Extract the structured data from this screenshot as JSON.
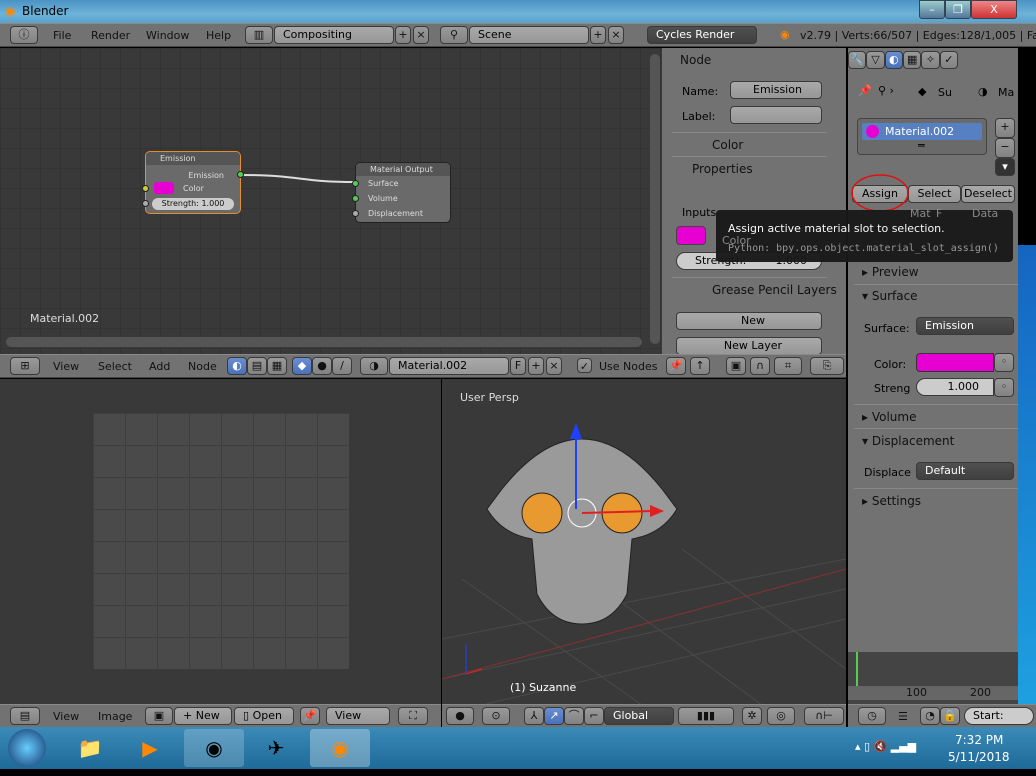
{
  "window": {
    "title": "Blender",
    "minimize": "–",
    "maximize": "❐",
    "close": "X"
  },
  "topbar": {
    "menus": [
      "File",
      "Render",
      "Window",
      "Help"
    ],
    "layout": "Compositing",
    "scene": "Scene",
    "engine": "Cycles Render",
    "stats": "v2.79 | Verts:66/507 | Edges:128/1,005 | Fa"
  },
  "node_editor": {
    "material_label": "Material.002",
    "emission_node": {
      "title": "Emission",
      "output": "Emission",
      "color_label": "Color",
      "strength": "Strength: 1.000"
    },
    "output_node": {
      "title": "Material Output",
      "inputs": [
        "Surface",
        "Volume",
        "Displacement"
      ]
    },
    "header": {
      "menus": [
        "View",
        "Select",
        "Add",
        "Node"
      ],
      "material": "Material.002",
      "fake_user": "F",
      "use_nodes": "Use Nodes",
      "use_nodes_checked": true
    }
  },
  "n_panel": {
    "node_title": "Node",
    "name_label": "Name:",
    "name_value": "Emission",
    "label_label": "Label:",
    "label_value": "",
    "color_title": "Color",
    "properties_title": "Properties",
    "inputs_label": "Inputs:",
    "color_input": "Color",
    "strength_label": "Strength:",
    "strength_value": "1.000",
    "grease_title": "Grease Pencil Layers",
    "new_label": "New",
    "new_layer_label": "New Layer"
  },
  "properties": {
    "breadcrumb": [
      "Su",
      "Ma"
    ],
    "slot": "Material.002",
    "assign": "Assign",
    "select": "Select",
    "deselect": "Deselect",
    "mat_field": "Mat",
    "f": "F",
    "data": "Data",
    "preview": "Preview",
    "surface_title": "Surface",
    "surface_label": "Surface:",
    "surface_value": "Emission",
    "color_label": "Color:",
    "strength_label": "Streng",
    "strength_value": "1.000",
    "volume": "Volume",
    "displacement": "Displacement",
    "displace_label": "Displace",
    "displace_value": "Default",
    "settings": "Settings"
  },
  "tooltip": {
    "text": "Assign active material slot to selection.",
    "python": "Python: bpy.ops.object.material_slot_assign()"
  },
  "viewport": {
    "view_name": "User Persp",
    "object": "(1) Suzanne",
    "orientation": "Global"
  },
  "image_editor": {
    "menus": [
      "View",
      "Image"
    ],
    "new": "New",
    "open": "Open",
    "view": "View"
  },
  "timeline": {
    "ticks": [
      "100",
      "200"
    ],
    "start": "Start:"
  },
  "taskbar": {
    "time": "7:32 PM",
    "date": "5/11/2018"
  },
  "colors": {
    "emission": "#e600d2",
    "accent": "#5680c2",
    "annotation": "#e01010"
  }
}
